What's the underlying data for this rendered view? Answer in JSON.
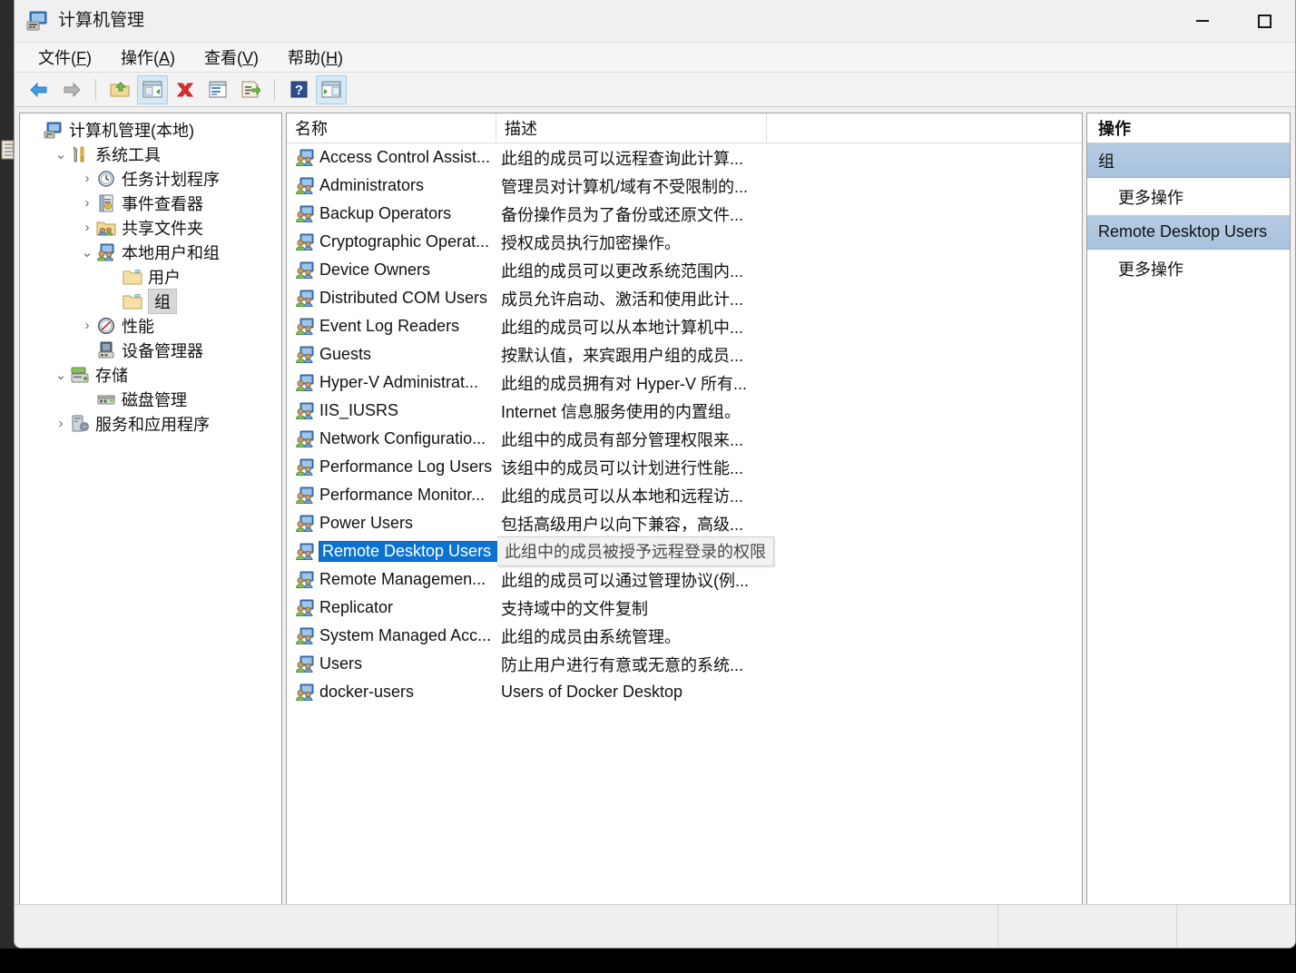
{
  "window": {
    "title": "计算机管理",
    "title_icon": "computer-management-icon",
    "minimize_label": "最小化",
    "maximize_label": "最大化"
  },
  "menubar": {
    "items": [
      {
        "label": "文件(F)",
        "pre": "文件(",
        "accel": "F",
        "post": ")"
      },
      {
        "label": "操作(A)",
        "pre": "操作(",
        "accel": "A",
        "post": ")"
      },
      {
        "label": "查看(V)",
        "pre": "查看(",
        "accel": "V",
        "post": ")"
      },
      {
        "label": "帮助(H)",
        "pre": "帮助(",
        "accel": "H",
        "post": ")"
      }
    ]
  },
  "toolbar": {
    "buttons": [
      {
        "name": "back-arrow-icon",
        "active": false
      },
      {
        "name": "forward-arrow-icon",
        "active": false
      },
      {
        "name": "up-folder-icon",
        "active": false
      },
      {
        "name": "show-hide-tree-icon",
        "active": true
      },
      {
        "name": "delete-x-icon",
        "active": false
      },
      {
        "name": "properties-icon",
        "active": false
      },
      {
        "name": "export-list-icon",
        "active": false
      },
      {
        "name": "help-icon",
        "active": false
      },
      {
        "name": "show-action-pane-icon",
        "active": true
      }
    ]
  },
  "tree": {
    "nodes": [
      {
        "label": "计算机管理(本地)",
        "indent": 0,
        "chevron": "",
        "icon": "computer-icon",
        "selected": false
      },
      {
        "label": "系统工具",
        "indent": 1,
        "chevron": "v",
        "icon": "tools-icon",
        "selected": false
      },
      {
        "label": "任务计划程序",
        "indent": 2,
        "chevron": ">",
        "icon": "clock-icon",
        "selected": false
      },
      {
        "label": "事件查看器",
        "indent": 2,
        "chevron": ">",
        "icon": "event-viewer-icon",
        "selected": false
      },
      {
        "label": "共享文件夹",
        "indent": 2,
        "chevron": ">",
        "icon": "shared-folder-icon",
        "selected": false
      },
      {
        "label": "本地用户和组",
        "indent": 2,
        "chevron": "v",
        "icon": "users-groups-icon",
        "selected": false
      },
      {
        "label": "用户",
        "indent": 3,
        "chevron": "",
        "icon": "folder-icon",
        "selected": false
      },
      {
        "label": "组",
        "indent": 3,
        "chevron": "",
        "icon": "folder-icon",
        "selected": true
      },
      {
        "label": "性能",
        "indent": 2,
        "chevron": ">",
        "icon": "performance-icon",
        "selected": false
      },
      {
        "label": "设备管理器",
        "indent": 2,
        "chevron": "",
        "icon": "device-manager-icon",
        "selected": false
      },
      {
        "label": "存储",
        "indent": 1,
        "chevron": "v",
        "icon": "storage-icon",
        "selected": false
      },
      {
        "label": "磁盘管理",
        "indent": 2,
        "chevron": "",
        "icon": "disk-management-icon",
        "selected": false
      },
      {
        "label": "服务和应用程序",
        "indent": 1,
        "chevron": ">",
        "icon": "services-icon",
        "selected": false
      }
    ]
  },
  "list": {
    "columns": [
      {
        "key": "name",
        "label": "名称"
      },
      {
        "key": "desc",
        "label": "描述"
      },
      {
        "key": "blank",
        "label": ""
      }
    ],
    "rows": [
      {
        "name": "Access Control Assist...",
        "desc": "此组的成员可以远程查询此计算...",
        "icon": "group-icon",
        "selected": false
      },
      {
        "name": "Administrators",
        "desc": "管理员对计算机/域有不受限制的...",
        "icon": "group-icon",
        "selected": false
      },
      {
        "name": "Backup Operators",
        "desc": "备份操作员为了备份或还原文件...",
        "icon": "group-icon",
        "selected": false
      },
      {
        "name": "Cryptographic Operat...",
        "desc": "授权成员执行加密操作。",
        "icon": "group-icon",
        "selected": false
      },
      {
        "name": "Device Owners",
        "desc": "此组的成员可以更改系统范围内...",
        "icon": "group-icon",
        "selected": false
      },
      {
        "name": "Distributed COM Users",
        "desc": "成员允许启动、激活和使用此计...",
        "icon": "group-icon",
        "selected": false
      },
      {
        "name": "Event Log Readers",
        "desc": "此组的成员可以从本地计算机中...",
        "icon": "group-icon",
        "selected": false
      },
      {
        "name": "Guests",
        "desc": "按默认值，来宾跟用户组的成员...",
        "icon": "group-icon",
        "selected": false
      },
      {
        "name": "Hyper-V Administrat...",
        "desc": "此组的成员拥有对 Hyper-V 所有...",
        "icon": "group-icon",
        "selected": false
      },
      {
        "name": "IIS_IUSRS",
        "desc": "Internet 信息服务使用的内置组。",
        "icon": "group-icon",
        "selected": false
      },
      {
        "name": "Network Configuratio...",
        "desc": "此组中的成员有部分管理权限来...",
        "icon": "group-icon",
        "selected": false
      },
      {
        "name": "Performance Log Users",
        "desc": "该组中的成员可以计划进行性能...",
        "icon": "group-icon",
        "selected": false
      },
      {
        "name": "Performance Monitor...",
        "desc": "此组的成员可以从本地和远程访...",
        "icon": "group-icon",
        "selected": false
      },
      {
        "name": "Power Users",
        "desc": "包括高级用户以向下兼容，高级...",
        "icon": "group-icon",
        "selected": false
      },
      {
        "name": "Remote Desktop Users",
        "desc": "此组中的成员被授予远程登录的权限",
        "icon": "group-icon",
        "selected": true
      },
      {
        "name": "Remote Managemen...",
        "desc": "此组的成员可以通过管理协议(例...",
        "icon": "group-icon",
        "selected": false
      },
      {
        "name": "Replicator",
        "desc": "支持域中的文件复制",
        "icon": "group-icon",
        "selected": false
      },
      {
        "name": "System Managed Acc...",
        "desc": "此组的成员由系统管理。",
        "icon": "group-icon",
        "selected": false
      },
      {
        "name": "Users",
        "desc": "防止用户进行有意或无意的系统...",
        "icon": "group-icon",
        "selected": false
      },
      {
        "name": "docker-users",
        "desc": "Users of Docker Desktop",
        "icon": "group-icon",
        "selected": false
      }
    ]
  },
  "actions": {
    "title": "操作",
    "sections": [
      {
        "group": "组",
        "items": [
          "更多操作"
        ]
      },
      {
        "group": "Remote Desktop Users",
        "items": [
          "更多操作"
        ]
      }
    ]
  },
  "statusbar": {
    "text": ""
  },
  "colors": {
    "selection_blue": "#0b72d0",
    "action_group_blue": "#a8c2dd",
    "window_bg": "#f0f0f0",
    "pane_bg": "#ffffff",
    "tree_selected_gray": "#d8d8d8",
    "toolbar_active": "#d6e9f8"
  }
}
